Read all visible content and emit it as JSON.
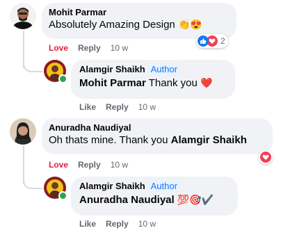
{
  "comments": [
    {
      "author": "Mohit Parmar",
      "text": "Absolutely Amazing Design",
      "emojis": [
        "👏",
        "😍"
      ],
      "reactions": {
        "count": "2",
        "icons": [
          "like",
          "love"
        ]
      },
      "actions": {
        "love": "Love",
        "reply": "Reply",
        "time": "10 w"
      },
      "reply": {
        "author": "Alamgir Shaikh",
        "badge": "Author",
        "mention": "Mohit Parmar",
        "text": "Thank you",
        "emoji": "❤️",
        "actions": {
          "like": "Like",
          "reply": "Reply",
          "time": "10 w"
        }
      }
    },
    {
      "author": "Anuradha Naudiyal",
      "text": "Oh thats mine. Thank you",
      "mention": "Alamgir Shaikh",
      "reactions": {
        "icons": [
          "love"
        ]
      },
      "actions": {
        "love": "Love",
        "reply": "Reply",
        "time": "10 w"
      },
      "reply": {
        "author": "Alamgir Shaikh",
        "badge": "Author",
        "mention": "Anuradha Naudiyal",
        "emoji": "💯🎯✔️",
        "actions": {
          "like": "Like",
          "reply": "Reply",
          "time": "10 w"
        }
      }
    }
  ],
  "colors": {
    "bubble": "#f0f2f5",
    "love": "#e41e3f",
    "link": "#1877f2",
    "meta": "#65676b",
    "thread_line": "#d8dadf"
  }
}
